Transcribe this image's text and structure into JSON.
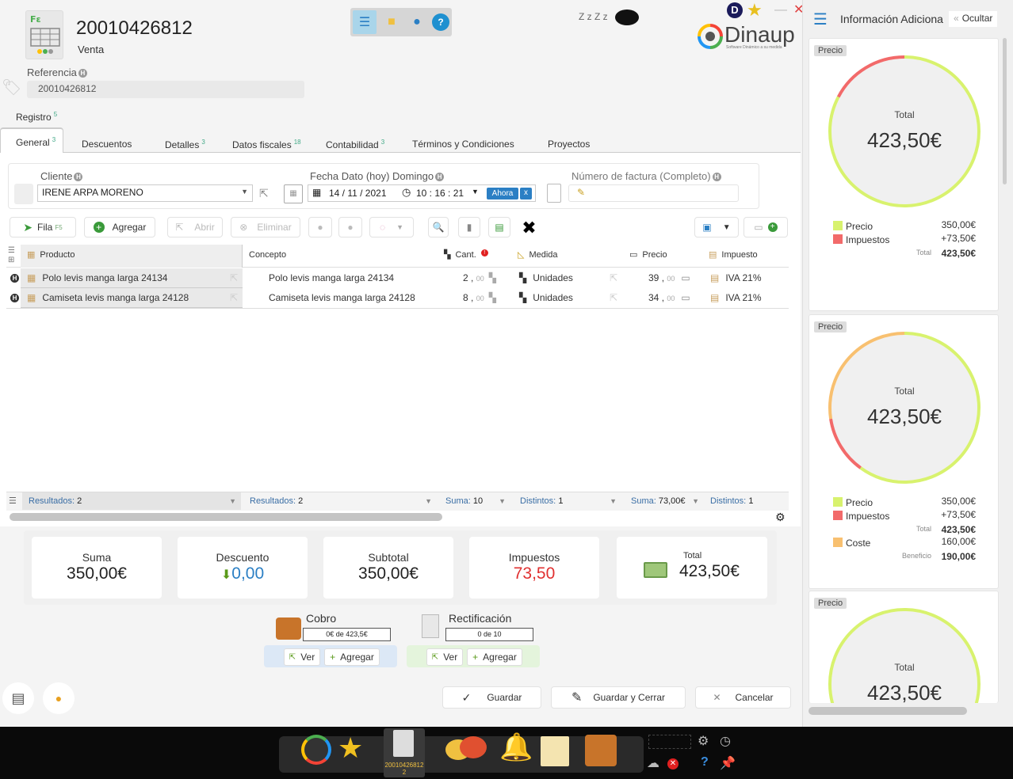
{
  "doc": {
    "number": "20010426812",
    "type": "Venta",
    "ref_label": "Referencia",
    "ref_value": "20010426812"
  },
  "brand": {
    "name": "Dinaup",
    "tagline": "Software Dinámico a su medida",
    "sleep": "Z z Z z",
    "user_initial": "D"
  },
  "tabs": {
    "registro": "Registro",
    "registro_count": "5",
    "items": [
      {
        "label": "General",
        "count": "3"
      },
      {
        "label": "Descuentos",
        "count": ""
      },
      {
        "label": "Detalles",
        "count": "3"
      },
      {
        "label": "Datos fiscales",
        "count": "18"
      },
      {
        "label": "Contabilidad",
        "count": "3"
      },
      {
        "label": "Términos y Condiciones",
        "count": ""
      },
      {
        "label": "Proyectos",
        "count": ""
      }
    ]
  },
  "form": {
    "cliente_label": "Cliente",
    "cliente_value": "IRENE ARPA MORENO",
    "fecha_label": "Fecha Dato (hoy) Domingo",
    "fecha_date": "14 / 11 / 2021",
    "fecha_time": "10 : 16 : 21",
    "ahora": "Ahora",
    "clear": "x",
    "factura_label": "Número de factura (Completo)",
    "factura_value": ""
  },
  "toolbar": {
    "fila": "Fila",
    "fila_key": "F5",
    "agregar": "Agregar",
    "abrir": "Abrir",
    "eliminar": "Eliminar"
  },
  "grid": {
    "headers": {
      "producto": "Producto",
      "concepto": "Concepto",
      "cant": "Cant.",
      "medida": "Medida",
      "precio": "Precio",
      "impuesto": "Impuesto"
    },
    "rows": [
      {
        "producto": "Polo levis manga larga 24134",
        "concepto": "Polo levis manga larga 24134",
        "cant": "2",
        "cant_dec": "00",
        "medida": "Unidades",
        "precio": "39",
        "precio_dec": "00",
        "impuesto": "IVA 21%"
      },
      {
        "producto": "Camiseta levis manga larga 24128",
        "concepto": "Camiseta levis manga larga 24128",
        "cant": "8",
        "cant_dec": "00",
        "medida": "Unidades",
        "precio": "34",
        "precio_dec": "00",
        "impuesto": "IVA 21%"
      }
    ],
    "footer": [
      {
        "k": "Resultados:",
        "v": "2"
      },
      {
        "k": "Resultados:",
        "v": "2"
      },
      {
        "k": "Suma:",
        "v": "10"
      },
      {
        "k": "Distintos:",
        "v": "1"
      },
      {
        "k": "Suma:",
        "v": "73,00€"
      },
      {
        "k": "Distintos:",
        "v": "1"
      }
    ]
  },
  "totals": {
    "suma_label": "Suma",
    "suma": "350,00€",
    "descuento_label": "Descuento",
    "descuento": "0,00",
    "subtotal_label": "Subtotal",
    "subtotal": "350,00€",
    "impuestos_label": "Impuestos",
    "impuestos": "73,50",
    "total_label": "Total",
    "total": "423,50€"
  },
  "cobro": {
    "label": "Cobro",
    "progress": "0€ de 423,5€",
    "ver": "Ver",
    "agregar": "Agregar"
  },
  "rect": {
    "label": "Rectificación",
    "progress": "0 de 10",
    "ver": "Ver",
    "agregar": "Agregar"
  },
  "actions": {
    "guardar": "Guardar",
    "guardar_cerrar": "Guardar y Cerrar",
    "cancelar": "Cancelar"
  },
  "panel": {
    "title": "Información Adiciona",
    "hide": "Ocultar",
    "cards": [
      {
        "tag": "Precio",
        "center_label": "Total",
        "center_value": "423,50€",
        "precio_label": "Precio",
        "precio": "350,00€",
        "imp_label": "Impuestos",
        "imp": "+73,50€",
        "total_label": "Total",
        "total": "423,50€"
      },
      {
        "tag": "Precio",
        "center_label": "Total",
        "center_value": "423,50€",
        "precio_label": "Precio",
        "precio": "350,00€",
        "imp_label": "Impuestos",
        "imp": "+73,50€",
        "total_label": "Total",
        "total": "423,50€",
        "coste_label": "Coste",
        "coste": "160,00€",
        "benef_label": "Beneficio",
        "benef": "190,00€"
      },
      {
        "tag": "Precio",
        "center_label": "Total",
        "center_value": "423,50€"
      }
    ]
  },
  "taskbar": {
    "doc_label": "20010426812",
    "doc_count": "2"
  },
  "colors": {
    "accent": "#2b7fc4",
    "green": "#d4f26a",
    "red": "#f06a6a",
    "orange": "#f8c070",
    "neg": "#e03030",
    "blue_val": "#2b7fc4"
  }
}
